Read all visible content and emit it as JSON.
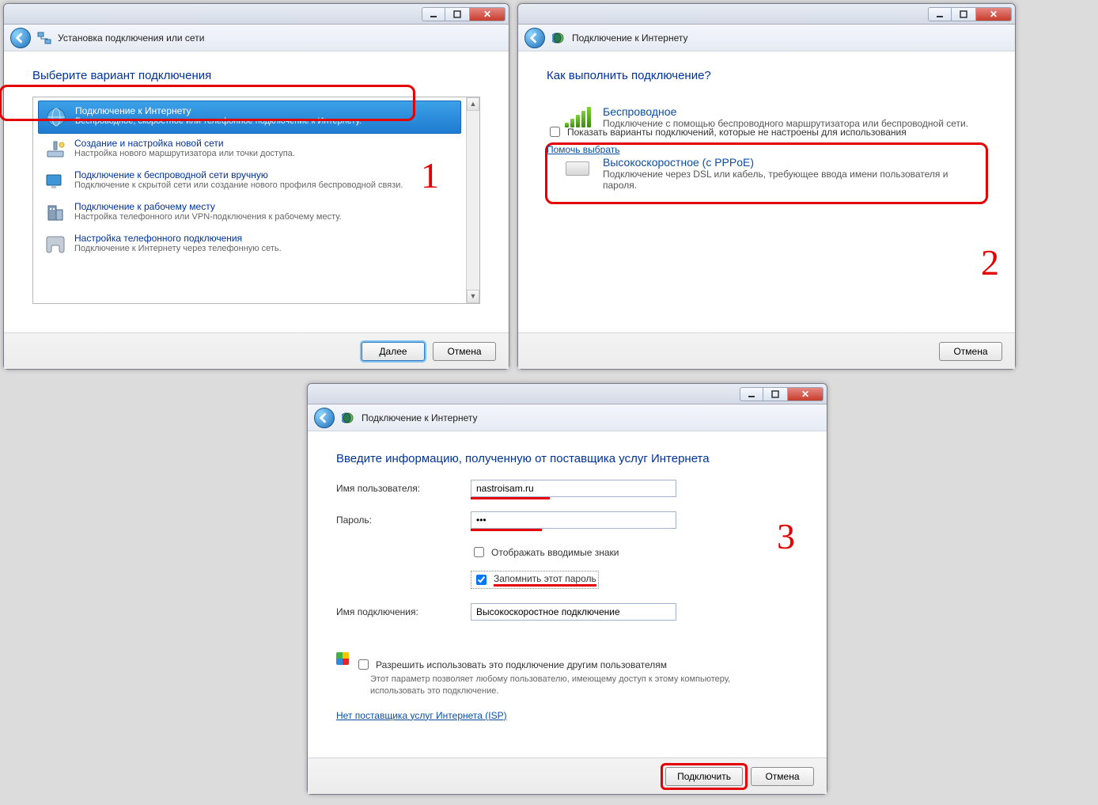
{
  "w1": {
    "crumb": "Установка подключения или сети",
    "heading": "Выберите вариант подключения",
    "options": [
      {
        "title": "Подключение к Интернету",
        "desc": "Беспроводное, скоростное или телефонное подключение к Интернету."
      },
      {
        "title": "Создание и настройка новой сети",
        "desc": "Настройка нового маршрутизатора или точки доступа."
      },
      {
        "title": "Подключение к беспроводной сети вручную",
        "desc": "Подключение к скрытой сети или создание нового профиля беспроводной связи."
      },
      {
        "title": "Подключение к рабочему месту",
        "desc": "Настройка телефонного или VPN-подключения к рабочему месту."
      },
      {
        "title": "Настройка телефонного подключения",
        "desc": "Подключение к Интернету через телефонную сеть."
      }
    ],
    "next": "Далее",
    "cancel": "Отмена",
    "num": "1"
  },
  "w2": {
    "crumb": "Подключение к Интернету",
    "heading": "Как выполнить подключение?",
    "opt_wireless": {
      "title": "Беспроводное",
      "desc": "Подключение с помощью беспроводного маршрутизатора или беспроводной сети."
    },
    "opt_pppoe": {
      "title": "Высокоскоростное (с PPPoE)",
      "desc": "Подключение через DSL или кабель, требующее ввода имени пользователя и пароля."
    },
    "show_unconfigured": "Показать варианты подключений, которые не настроены для использования",
    "help_choose": "Помочь выбрать",
    "cancel": "Отмена",
    "num": "2"
  },
  "w3": {
    "crumb": "Подключение к Интернету",
    "heading": "Введите информацию, полученную от поставщика услуг Интернета",
    "lbl_user": "Имя пользователя:",
    "val_user": "nastroisam.ru",
    "lbl_pass": "Пароль:",
    "val_pass": "•••",
    "show_chars": "Отображать вводимые знаки",
    "remember": "Запомнить этот пароль",
    "lbl_conn": "Имя подключения:",
    "val_conn": "Высокоскоростное подключение",
    "allow_others": "Разрешить использовать это подключение другим пользователям",
    "allow_desc": "Этот параметр позволяет любому пользователю, имеющему доступ к этому компьютеру, использовать это подключение.",
    "no_isp": "Нет поставщика услуг Интернета (ISP)",
    "connect": "Подключить",
    "cancel": "Отмена",
    "num": "3"
  }
}
